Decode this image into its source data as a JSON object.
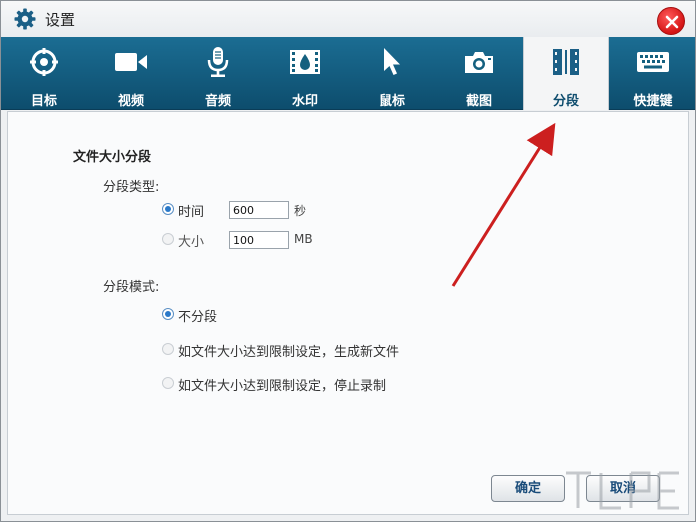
{
  "window": {
    "title": "设置"
  },
  "toolbar": {
    "tabs": [
      {
        "label": "目标",
        "icon": "target-icon"
      },
      {
        "label": "视频",
        "icon": "video-camera-icon"
      },
      {
        "label": "音频",
        "icon": "microphone-icon"
      },
      {
        "label": "水印",
        "icon": "watermark-film-icon"
      },
      {
        "label": "鼠标",
        "icon": "mouse-cursor-icon"
      },
      {
        "label": "截图",
        "icon": "camera-icon"
      },
      {
        "label": "分段",
        "icon": "segment-film-icon",
        "active": true
      },
      {
        "label": "快捷键",
        "icon": "keyboard-icon"
      }
    ]
  },
  "segment": {
    "section_title": "文件大小分段",
    "type_label": "分段类型:",
    "type_options": [
      {
        "label": "时间",
        "value": "600",
        "unit": "秒",
        "checked": true
      },
      {
        "label": "大小",
        "value": "100",
        "unit": "MB",
        "checked": false
      }
    ],
    "mode_label": "分段模式:",
    "mode_options": [
      {
        "label": "不分段",
        "checked": true
      },
      {
        "label": "如文件大小达到限制设定，生成新文件",
        "checked": false
      },
      {
        "label": "如文件大小达到限制设定，停止录制",
        "checked": false
      }
    ]
  },
  "buttons": {
    "ok": "确定",
    "cancel": "取消"
  },
  "colors": {
    "toolbar": "#14607f",
    "accent": "#2a79c9",
    "arrow": "#cc1f1f",
    "close": "#e02020"
  }
}
